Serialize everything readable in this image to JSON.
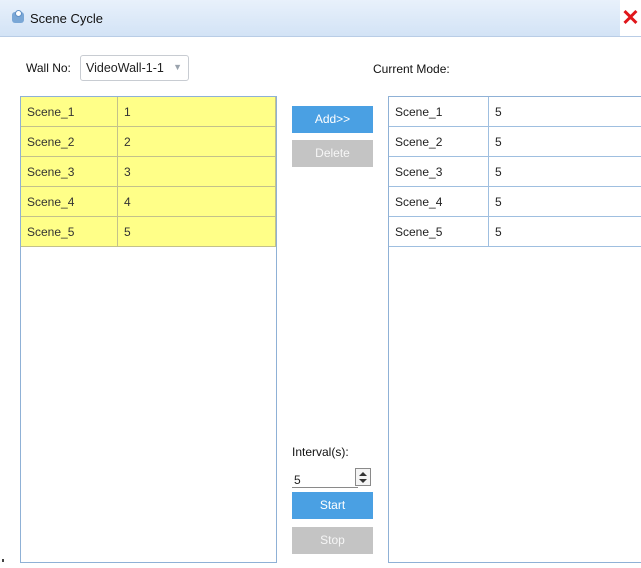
{
  "window": {
    "title": "Scene Cycle",
    "close_glyph": "✕"
  },
  "wall": {
    "label": "Wall No:",
    "selected": "VideoWall-1-1",
    "arrow_glyph": "▼"
  },
  "current_mode": {
    "label": "Current Mode:"
  },
  "available_scenes": [
    {
      "name": "Scene_1",
      "value": "1"
    },
    {
      "name": "Scene_2",
      "value": "2"
    },
    {
      "name": "Scene_3",
      "value": "3"
    },
    {
      "name": "Scene_4",
      "value": "4"
    },
    {
      "name": "Scene_5",
      "value": "5"
    }
  ],
  "cycle_scenes": [
    {
      "name": "Scene_1",
      "value": "5"
    },
    {
      "name": "Scene_2",
      "value": "5"
    },
    {
      "name": "Scene_3",
      "value": "5"
    },
    {
      "name": "Scene_4",
      "value": "5"
    },
    {
      "name": "Scene_5",
      "value": "5"
    }
  ],
  "buttons": {
    "add": "Add>>",
    "delete": "Delete",
    "start": "Start",
    "stop": "Stop"
  },
  "interval": {
    "label": "Interval(s):",
    "value": "5"
  },
  "colors": {
    "selected_row": "#ffff88",
    "button_blue": "#4aa0e3",
    "button_disabled": "#c4c4c4",
    "close": "#e0161b"
  }
}
